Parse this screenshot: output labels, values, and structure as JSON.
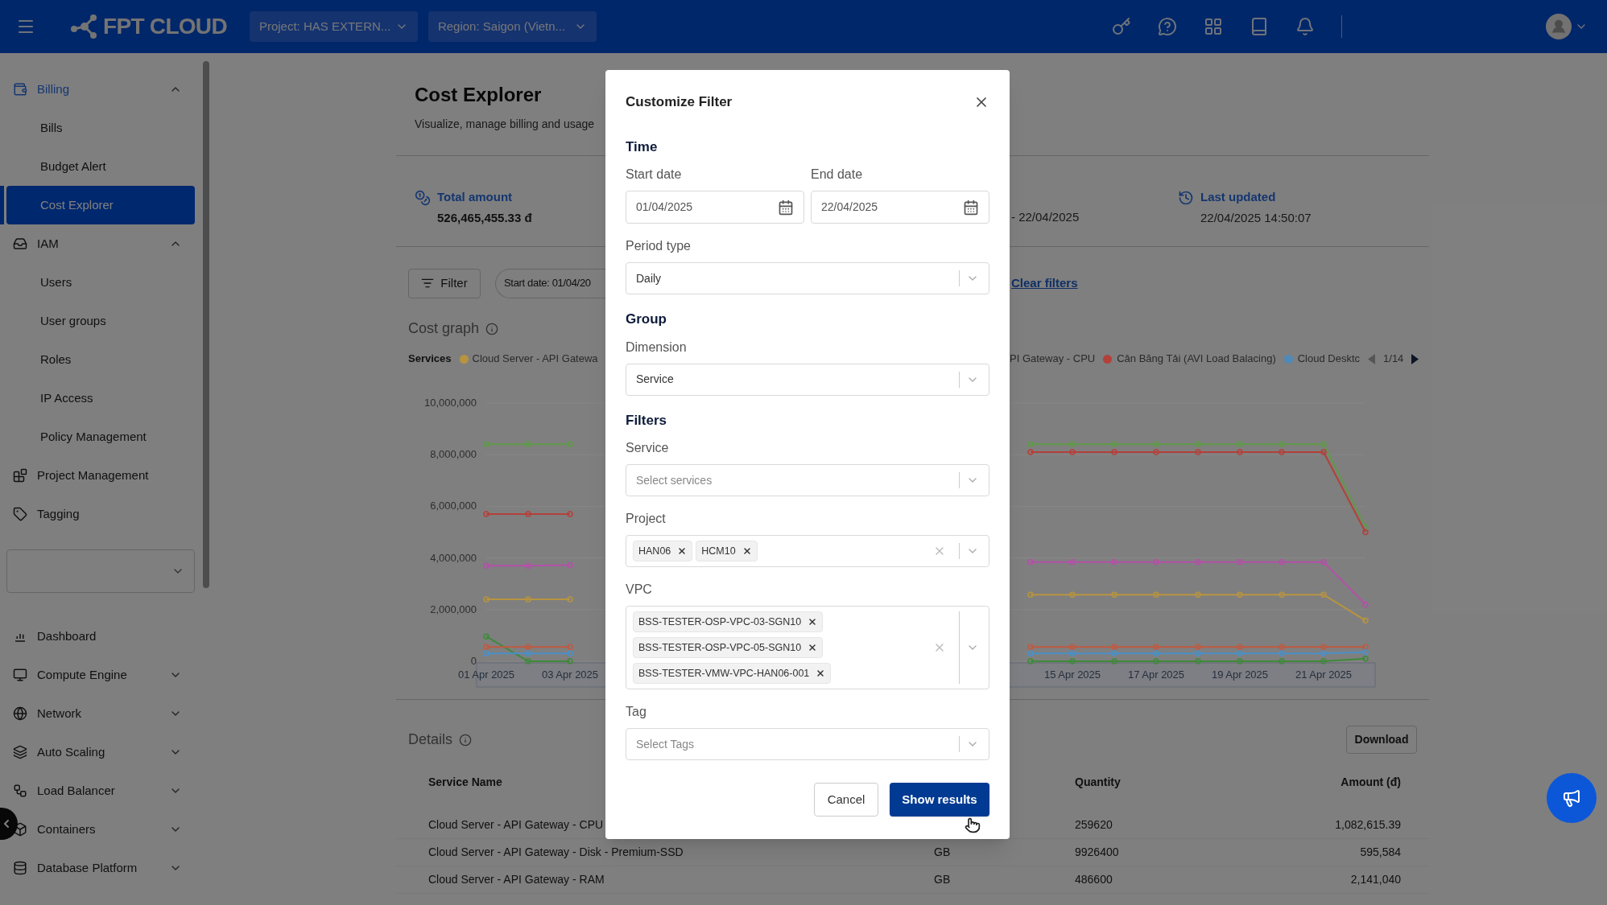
{
  "header": {
    "logo": "FPT CLOUD",
    "project_select": "Project: HAS EXTERN...",
    "region_select": "Region: Saigon (Vietn..."
  },
  "sidebar": {
    "top_items": [
      {
        "label": "Billing",
        "active": true,
        "expanded": true,
        "children": [
          {
            "label": "Bills",
            "selected": false
          },
          {
            "label": "Budget Alert",
            "selected": false
          },
          {
            "label": "Cost Explorer",
            "selected": true
          }
        ]
      },
      {
        "label": "IAM",
        "active": false,
        "expanded": true,
        "children": [
          {
            "label": "Users",
            "selected": false
          },
          {
            "label": "User groups",
            "selected": false
          },
          {
            "label": "Roles",
            "selected": false
          },
          {
            "label": "IP Access",
            "selected": false
          },
          {
            "label": "Policy Management",
            "selected": false
          }
        ]
      },
      {
        "label": "Project Management",
        "active": false
      },
      {
        "label": "Tagging",
        "active": false
      }
    ],
    "bottom_items": [
      {
        "label": "Dashboard",
        "active": false
      },
      {
        "label": "Compute Engine",
        "active": false,
        "expanded": false
      },
      {
        "label": "Network",
        "active": false,
        "expanded": false
      },
      {
        "label": "Auto Scaling",
        "active": false,
        "expanded": false
      },
      {
        "label": "Load Balancer",
        "active": false,
        "expanded": false
      },
      {
        "label": "Containers",
        "active": false,
        "expanded": false
      },
      {
        "label": "Database Platform",
        "active": false,
        "expanded": false
      }
    ]
  },
  "page": {
    "title": "Cost Explorer",
    "subtitle": "Visualize, manage billing and usage",
    "stats": {
      "total_label": "Total amount",
      "total_value": "526,465,455.33 đ",
      "period_value": "- 22/04/2025",
      "updated_label": "Last updated",
      "updated_value": "22/04/2025 14:50:07"
    },
    "filter_button": "Filter",
    "filter_chip": "Start date: 01/04/20",
    "clear_filters": "Clear filters",
    "cost_graph": {
      "title": "Cost graph",
      "legend_title": "Services",
      "legend": [
        {
          "label": "Cloud Server - API Gatewa",
          "color": "#b89440"
        },
        {
          "label": "PI Gateway - CPU"
        },
        {
          "label": "Cân Băng Tải (AVI Load Balacing)",
          "color": "#b4403a"
        },
        {
          "label": "Cloud Desktc",
          "color": "#4f8ab8"
        }
      ],
      "pager": "1/14",
      "chart_data": {
        "type": "line",
        "categories": [
          "01 Apr 2025",
          null,
          "03 Apr 2025",
          null,
          null,
          null,
          null,
          null,
          null,
          null,
          null,
          null,
          null,
          null,
          "15 Apr 2025",
          null,
          "17 Apr 2025",
          null,
          "19 Apr 2025",
          null,
          "21 Apr 2025",
          null
        ],
        "yticks": [
          {
            "value": 0,
            "label": "0"
          },
          {
            "value": 2000000,
            "label": "2,000,000"
          },
          {
            "value": 4000000,
            "label": "4,000,000"
          },
          {
            "value": 6000000,
            "label": "6,000,000"
          },
          {
            "value": 8000000,
            "label": "8,000,000"
          },
          {
            "value": 10000000,
            "label": "10,000,000"
          }
        ],
        "ylim": [
          0,
          10000000
        ],
        "grid": true,
        "series": [
          {
            "color": "#5f9a48",
            "marker": "circle",
            "values": [
              8400000,
              8400000,
              8400000,
              null,
              null,
              null,
              null,
              null,
              null,
              null,
              null,
              null,
              null,
              8400000,
              8400000,
              8400000,
              8400000,
              8400000,
              8400000,
              8400000,
              8400000,
              5200000
            ]
          },
          {
            "color": "#b4403a",
            "marker": "circle",
            "values": [
              5700000,
              5700000,
              5700000,
              null,
              null,
              null,
              null,
              null,
              null,
              null,
              null,
              null,
              null,
              8100000,
              8100000,
              8100000,
              8100000,
              8100000,
              8100000,
              8100000,
              8100000,
              5000000
            ]
          },
          {
            "color": "#b450a8",
            "marker": "circle",
            "values": [
              3700000,
              3700000,
              3720000,
              null,
              null,
              null,
              null,
              null,
              null,
              null,
              null,
              null,
              null,
              3840000,
              3840000,
              3840000,
              3840000,
              3840000,
              3840000,
              3840000,
              3840000,
              2200000
            ]
          },
          {
            "color": "#b89440",
            "marker": "circle",
            "values": [
              2400000,
              2400000,
              2400000,
              null,
              null,
              null,
              null,
              null,
              null,
              null,
              null,
              null,
              null,
              2580000,
              2580000,
              2580000,
              2580000,
              2580000,
              2580000,
              2580000,
              2580000,
              1580000
            ]
          },
          {
            "color": "#3f8a3a",
            "marker": "circle",
            "values": [
              960000,
              0,
              0,
              null,
              null,
              null,
              null,
              null,
              null,
              null,
              null,
              null,
              null,
              0,
              0,
              0,
              0,
              0,
              0,
              0,
              0,
              100000
            ]
          },
          {
            "color": "#c05a40",
            "marker": "circle",
            "values": [
              550000,
              550000,
              550000,
              null,
              null,
              null,
              null,
              null,
              null,
              null,
              null,
              null,
              null,
              550000,
              550000,
              550000,
              550000,
              550000,
              550000,
              550000,
              550000,
              550000
            ]
          },
          {
            "color": "#4a90c8",
            "marker": "circle",
            "values": [
              300000,
              300000,
              300000,
              null,
              null,
              null,
              null,
              null,
              null,
              null,
              null,
              null,
              null,
              300000,
              300000,
              300000,
              300000,
              300000,
              300000,
              300000,
              300000,
              350000
            ]
          }
        ]
      }
    },
    "details": {
      "title": "Details",
      "download": "Download",
      "columns": [
        {
          "label": "Service Name"
        },
        {
          "label": "Quantity"
        },
        {
          "label": "Amount (đ)"
        }
      ],
      "rows": [
        {
          "service": "Cloud Server - API Gateway - CPU",
          "quantity": "259620",
          "amount": "1,082,615.39"
        },
        {
          "service": "Cloud Server - API Gateway - Disk - Premium-SSD",
          "unit": "GB",
          "quantity": "9926400",
          "amount": "595,584"
        },
        {
          "service": "Cloud Server - API Gateway - RAM",
          "unit": "GB",
          "quantity": "486600",
          "amount": "2,141,040"
        }
      ]
    }
  },
  "modal": {
    "title": "Customize Filter",
    "time": {
      "heading": "Time",
      "start": {
        "label": "Start date",
        "value": "01/04/2025"
      },
      "end": {
        "label": "End date",
        "value": "22/04/2025"
      }
    },
    "period_type": {
      "label": "Period type",
      "value": "Daily"
    },
    "group": {
      "heading": "Group",
      "dimension": {
        "label": "Dimension",
        "value": "Service"
      }
    },
    "filters": {
      "heading": "Filters",
      "service": {
        "label": "Service",
        "placeholder": "Select services"
      },
      "project": {
        "label": "Project",
        "tags": [
          "HAN06",
          "HCM10"
        ]
      },
      "vpc": {
        "label": "VPC",
        "tags": [
          "BSS-TESTER-OSP-VPC-03-SGN10",
          "BSS-TESTER-OSP-VPC-05-SGN10",
          "BSS-TESTER-VMW-VPC-HAN06-001"
        ]
      },
      "tag": {
        "label": "Tag",
        "placeholder": "Select Tags"
      }
    },
    "buttons": [
      {
        "label": "Cancel",
        "kind": "secondary"
      },
      {
        "label": "Show results",
        "kind": "primary"
      }
    ]
  }
}
